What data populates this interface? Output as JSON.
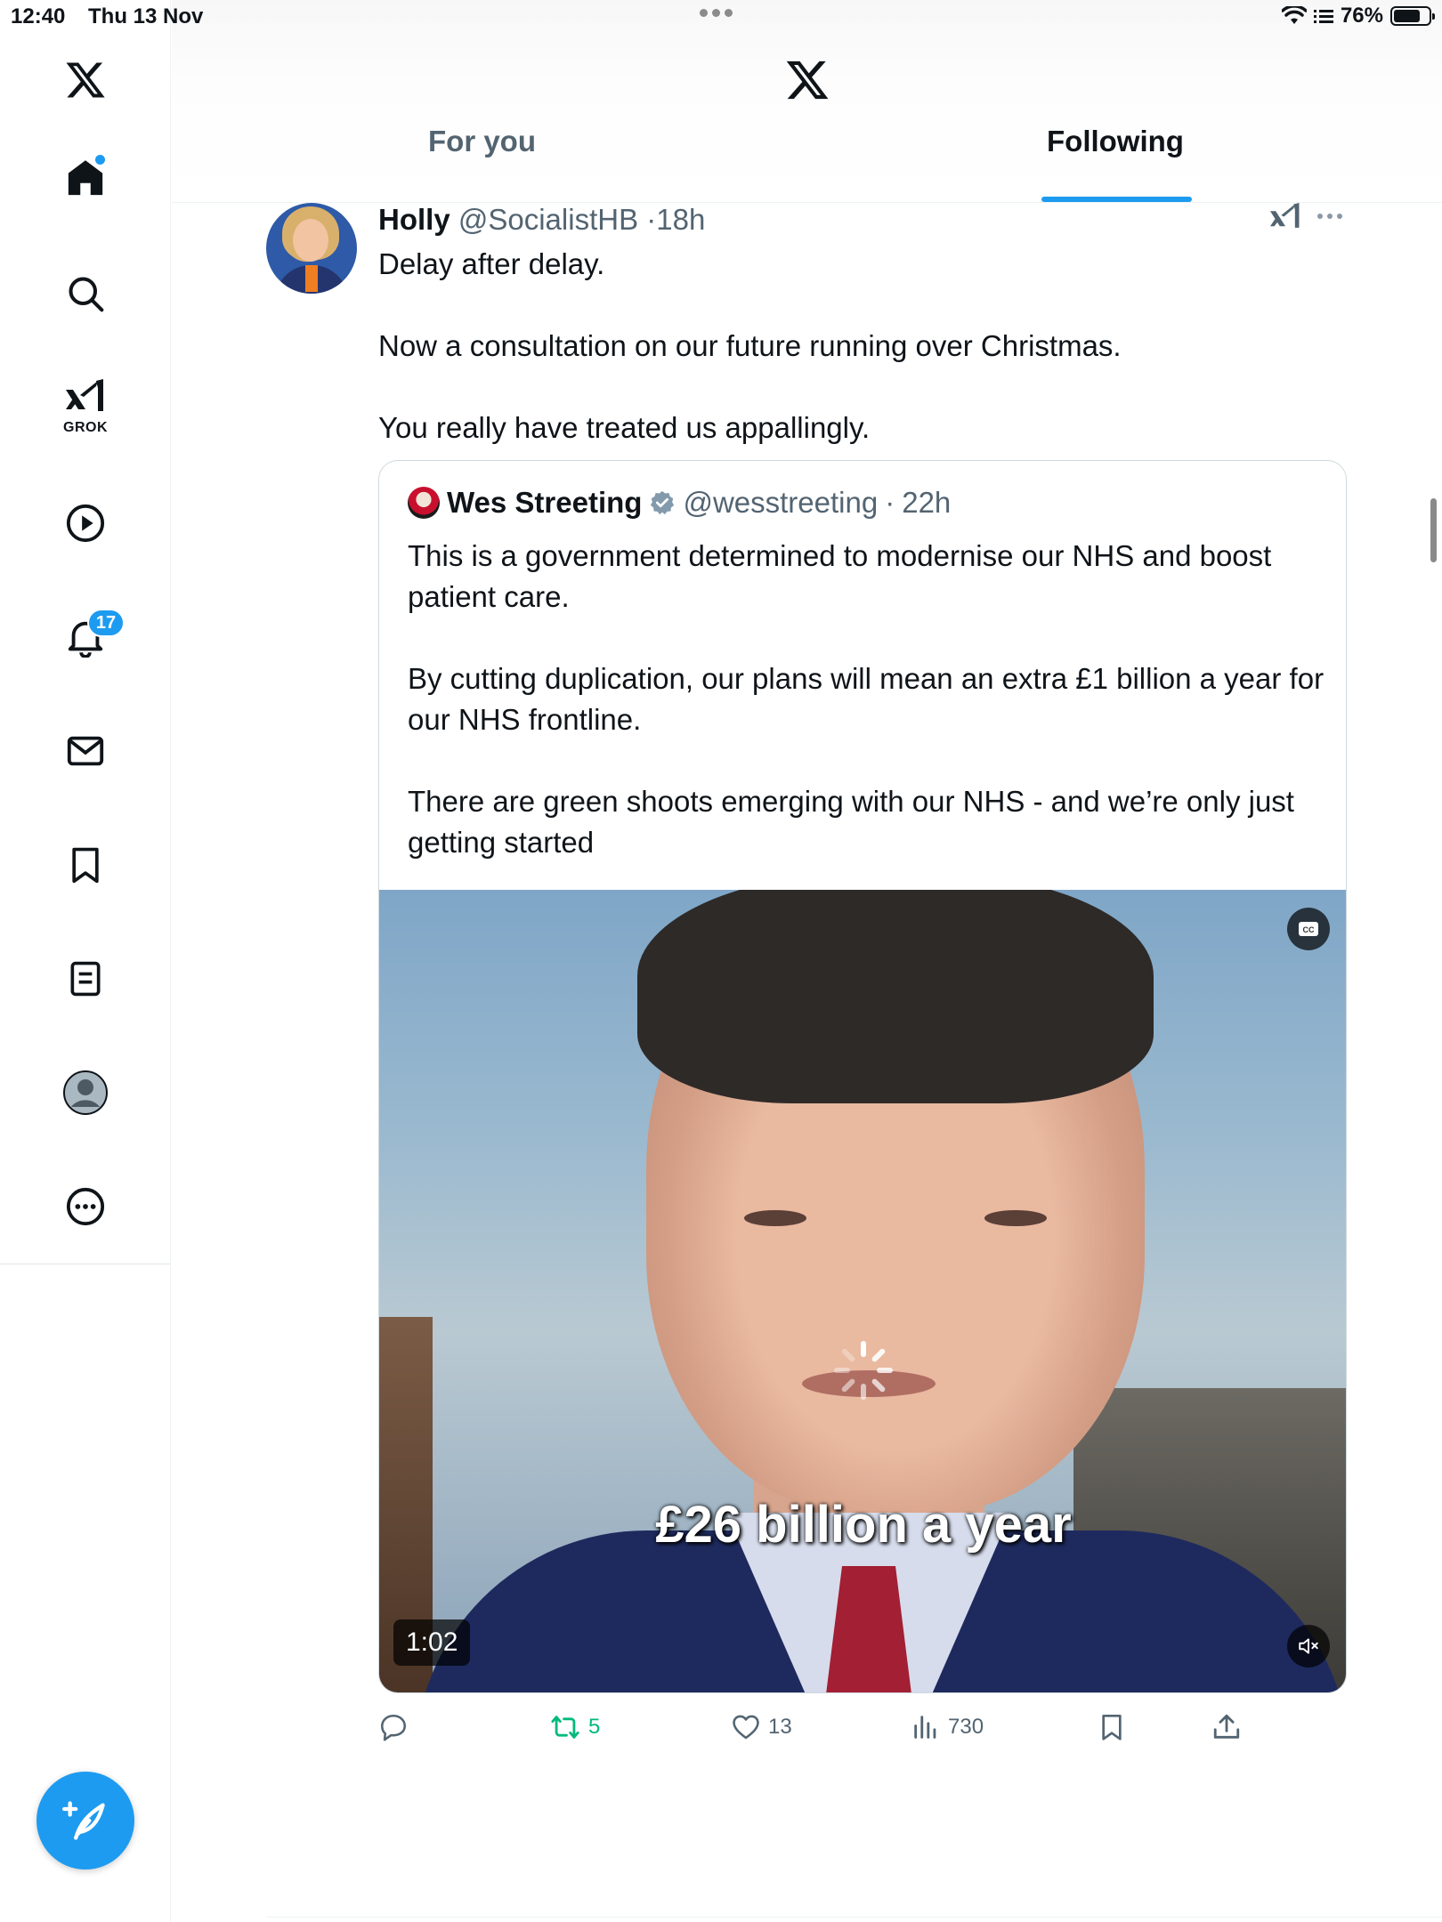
{
  "status_bar": {
    "time": "12:40",
    "date": "Thu 13 Nov",
    "battery": "76%",
    "battery_level": 0.76
  },
  "sidebar": {
    "items": [
      {
        "icon": "x-logo-icon"
      },
      {
        "icon": "home-icon"
      },
      {
        "icon": "search-icon"
      },
      {
        "icon": "grok-icon",
        "label": "GROK"
      },
      {
        "icon": "video-play-icon"
      },
      {
        "icon": "bell-icon",
        "badge": "17"
      },
      {
        "icon": "mail-icon"
      },
      {
        "icon": "bookmark-icon"
      },
      {
        "icon": "lists-icon"
      },
      {
        "icon": "profile-icon"
      },
      {
        "icon": "more-circle-icon"
      }
    ],
    "compose_icon": "feather-plus-icon"
  },
  "header": {
    "tabs": [
      {
        "label": "For you",
        "active": false
      },
      {
        "label": "Following",
        "active": true
      }
    ]
  },
  "tweet": {
    "name": "Holly",
    "handle": "@SocialistHB",
    "time": "18h",
    "text": "Delay after delay.\n\nNow a consultation on our future running over Christmas.\n\nYou really have treated us appallingly.",
    "quote": {
      "name": "Wes Streeting",
      "verified": true,
      "handle": "@wesstreeting",
      "time": "22h",
      "text": "This is a government determined to modernise our NHS and boost patient care.\n\nBy cutting duplication, our plans will mean an extra £1 billion a year for our NHS frontline.\n\nThere are green shoots emerging with our NHS - and we’re only just getting started",
      "video": {
        "caption": "£26 billion a year",
        "duration": "1:02"
      }
    },
    "actions": {
      "reply": "",
      "retweets": "5",
      "likes": "13",
      "views": "730"
    }
  },
  "colors": {
    "accent": "#1d9bf0",
    "retweet_active": "#00ba7c",
    "secondary_text": "#536471"
  }
}
